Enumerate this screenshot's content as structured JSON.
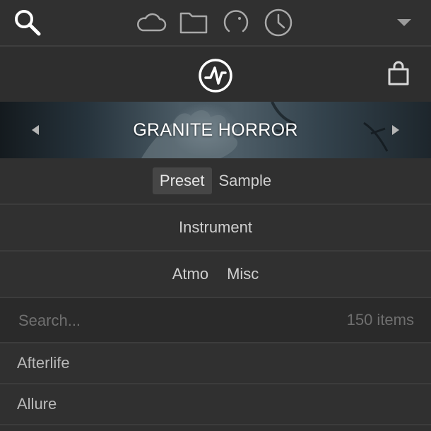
{
  "toolbar": {
    "icons": [
      "search-icon",
      "cloud-icon",
      "folder-icon",
      "knob-icon",
      "clock-icon",
      "dropdown-triangle-icon"
    ]
  },
  "header": {
    "logo": "waveform-logo-icon",
    "cart": "shopping-bag-icon"
  },
  "banner": {
    "title": "GRANITE HORROR"
  },
  "type_tabs": [
    {
      "label": "Preset",
      "active": true
    },
    {
      "label": "Sample",
      "active": false
    }
  ],
  "instrument_row": {
    "label": "Instrument"
  },
  "categories": [
    "Atmo",
    "Misc"
  ],
  "search": {
    "placeholder": "Search...",
    "value": "",
    "count": "150 items"
  },
  "results": [
    {
      "label": "Afterlife"
    },
    {
      "label": "Allure"
    }
  ],
  "colors": {
    "background": "#2f2f2f",
    "text": "#cfcfcf",
    "active_tab": "#464646",
    "divider": "#3c3c3c"
  }
}
